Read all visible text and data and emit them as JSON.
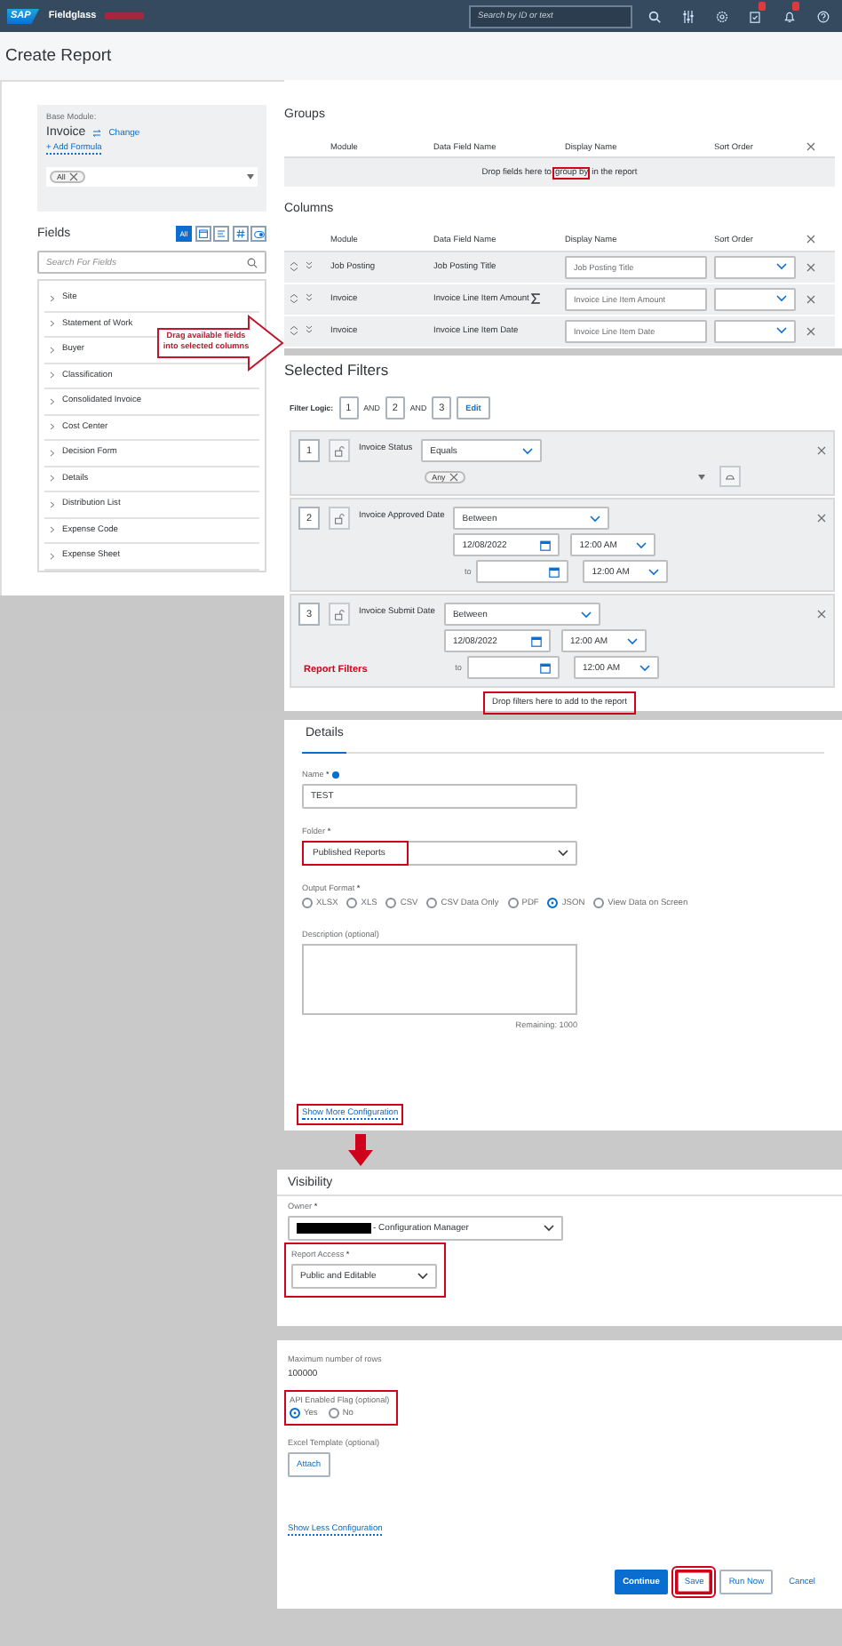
{
  "header": {
    "logo": "SAP",
    "product": "Fieldglass",
    "search": {
      "placeholder": "Search by ID or text"
    },
    "icons": [
      {
        "kind": "search",
        "badge": false
      },
      {
        "kind": "filters",
        "badge": false
      },
      {
        "kind": "settings",
        "badge": false
      },
      {
        "kind": "tasks",
        "badge": true
      },
      {
        "kind": "bell",
        "badge": true
      },
      {
        "kind": "help",
        "badge": false
      }
    ]
  },
  "page_title": "Create Report",
  "base_module": {
    "label": "Base Module:",
    "value": "Invoice",
    "change_link": "Change",
    "add_formula": "+ Add Formula",
    "tokens": [
      "All"
    ]
  },
  "fields": {
    "title": "Fields",
    "type_filters": [
      {
        "kind": "all",
        "label": "All",
        "selected": true
      },
      {
        "kind": "date",
        "selected": false
      },
      {
        "kind": "text",
        "selected": false
      },
      {
        "kind": "number",
        "selected": false
      },
      {
        "kind": "boolean",
        "selected": false
      }
    ],
    "search_placeholder": "Search For Fields",
    "items": [
      "Site",
      "Statement of Work",
      "Buyer",
      "Classification",
      "Consolidated Invoice",
      "Cost Center",
      "Decision Form",
      "Details",
      "Distribution List",
      "Expense Code",
      "Expense Sheet"
    ],
    "callout": "Drag available fields into selected columns"
  },
  "groups": {
    "title": "Groups",
    "headers": [
      "Module",
      "Data Field Name",
      "Display Name",
      "Sort Order"
    ],
    "drop_hint": {
      "before": "Drop fields here to",
      "highlight": "group by",
      "after": "in the report"
    }
  },
  "columns": {
    "title": "Columns",
    "headers": [
      "Module",
      "Data Field Name",
      "Display Name",
      "Sort Order"
    ],
    "rows": [
      {
        "module": "Job Posting",
        "field": "Job Posting Title",
        "display": "Job Posting Title",
        "summable": false
      },
      {
        "module": "Invoice",
        "field": "Invoice Line Item Amount",
        "display": "Invoice Line Item Amount",
        "summable": true
      },
      {
        "module": "Invoice",
        "field": "Invoice Line Item Date",
        "display": "Invoice Line Item Date",
        "summable": false
      }
    ]
  },
  "selected_filters": {
    "title": "Selected Filters",
    "logic_label": "Filter Logic:",
    "logic": [
      {
        "kind": "ref",
        "text": "1"
      },
      {
        "kind": "op",
        "text": "AND"
      },
      {
        "kind": "ref",
        "text": "2"
      },
      {
        "kind": "op",
        "text": "AND"
      },
      {
        "kind": "ref",
        "text": "3"
      }
    ],
    "edit": "Edit",
    "filters": [
      {
        "number": "1",
        "field": "Invoice Status",
        "kind": "list",
        "operator": "Equals",
        "tokens": [
          "Any"
        ]
      },
      {
        "number": "2",
        "field": "Invoice Approved Date",
        "kind": "date_range",
        "operator": "Between",
        "from_date": "12/08/2022",
        "from_time": "12:00 AM",
        "to_label": "to",
        "to_time": "12:00 AM"
      },
      {
        "number": "3",
        "field": "Invoice Submit Date",
        "kind": "date_range",
        "operator": "Between",
        "from_date": "12/08/2022",
        "from_time": "12:00 AM",
        "to_label": "to",
        "to_time": "12:00 AM",
        "annotation": "Report Filters"
      }
    ],
    "drop_hint": "Drop filters here to add to the report",
    "drop_highlighted": true
  },
  "details": {
    "title": "Details",
    "name": {
      "label": "Name",
      "mark": "*",
      "value": "TEST"
    },
    "folder": {
      "label": "Folder",
      "mark": "*",
      "value": "Published Reports",
      "highlighted": true
    },
    "output_format": {
      "label": "Output Format",
      "mark": "*",
      "options": [
        {
          "label": "XLSX",
          "selected": false
        },
        {
          "label": "XLS",
          "selected": false
        },
        {
          "label": "CSV",
          "selected": false
        },
        {
          "label": "CSV Data Only",
          "selected": false
        },
        {
          "label": "PDF",
          "selected": false
        },
        {
          "label": "JSON",
          "selected": true
        },
        {
          "label": "View Data on Screen",
          "selected": false
        }
      ]
    },
    "description": {
      "label": "Description (optional)",
      "remaining": "Remaining: 1000"
    },
    "show_more": {
      "text": "Show More Configuration",
      "highlighted": true
    }
  },
  "visibility": {
    "title": "Visibility",
    "owner": {
      "label": "Owner",
      "mark": "*",
      "value": "- Configuration Manager",
      "redacted": true
    },
    "report_access": {
      "label": "Report Access",
      "mark": "*",
      "value": "Public and Editable",
      "highlighted": true
    },
    "max_rows": {
      "label": "Maximum number of rows",
      "value": "100000"
    },
    "api_flag": {
      "label": "API Enabled Flag (optional)",
      "highlighted": true,
      "options": [
        {
          "label": "Yes",
          "selected": true
        },
        {
          "label": "No",
          "selected": false
        }
      ]
    },
    "excel_template": {
      "label": "Excel Template (optional)",
      "button": "Attach"
    },
    "show_less": "Show Less Configuration",
    "actions": [
      {
        "label": "Continue",
        "kind": "primary",
        "highlighted": false
      },
      {
        "label": "Save",
        "kind": "secondary",
        "highlighted": true
      },
      {
        "label": "Run Now",
        "kind": "secondary",
        "highlighted": false
      },
      {
        "label": "Cancel",
        "kind": "plain",
        "highlighted": false
      }
    ]
  }
}
